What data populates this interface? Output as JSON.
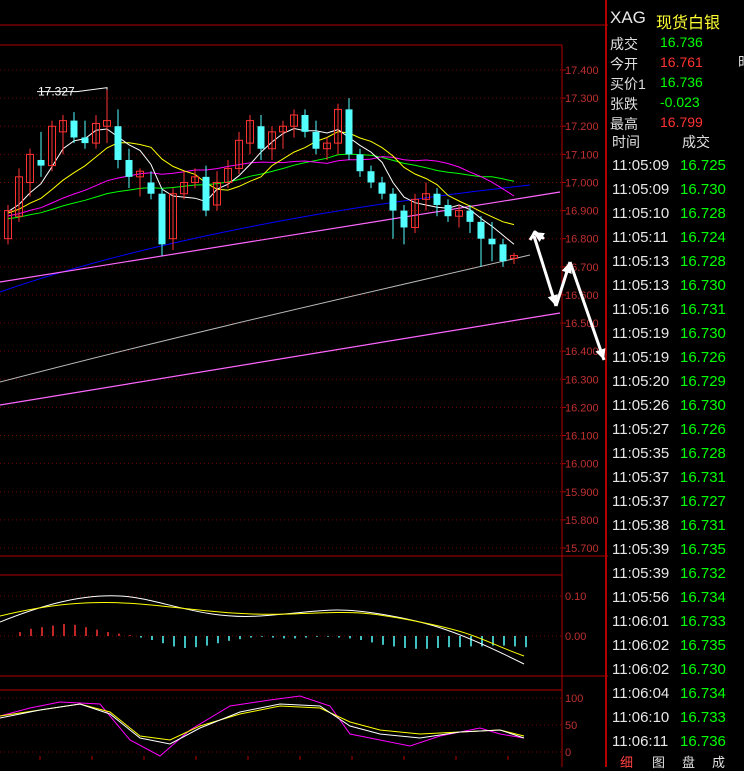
{
  "chart_data": {
    "type": "candlestick",
    "title": "",
    "price_axis_ticks": [
      "17.400",
      "17.300",
      "17.200",
      "17.100",
      "17.000",
      "16.900",
      "16.800",
      "16.700",
      "16.600",
      "16.500",
      "16.400",
      "16.300",
      "16.200",
      "16.100",
      "16.000",
      "15.900",
      "15.800",
      "15.700"
    ],
    "ylim": [
      15.7,
      17.4
    ],
    "high_annotation": "17.327",
    "candles": [
      {
        "o": 16.8,
        "h": 16.92,
        "l": 16.78,
        "c": 16.9
      },
      {
        "o": 16.88,
        "h": 17.05,
        "l": 16.86,
        "c": 17.02
      },
      {
        "o": 17.0,
        "h": 17.12,
        "l": 16.95,
        "c": 17.1
      },
      {
        "o": 17.08,
        "h": 17.18,
        "l": 17.02,
        "c": 17.06
      },
      {
        "o": 17.06,
        "h": 17.22,
        "l": 17.04,
        "c": 17.2
      },
      {
        "o": 17.18,
        "h": 17.24,
        "l": 17.1,
        "c": 17.22
      },
      {
        "o": 17.22,
        "h": 17.25,
        "l": 17.14,
        "c": 17.16
      },
      {
        "o": 17.16,
        "h": 17.22,
        "l": 17.12,
        "c": 17.14
      },
      {
        "o": 17.14,
        "h": 17.24,
        "l": 17.12,
        "c": 17.21
      },
      {
        "o": 17.2,
        "h": 17.33,
        "l": 17.14,
        "c": 17.22
      },
      {
        "o": 17.2,
        "h": 17.26,
        "l": 17.05,
        "c": 17.08
      },
      {
        "o": 17.08,
        "h": 17.12,
        "l": 16.98,
        "c": 17.02
      },
      {
        "o": 17.02,
        "h": 17.05,
        "l": 16.95,
        "c": 17.04
      },
      {
        "o": 17.0,
        "h": 17.04,
        "l": 16.94,
        "c": 16.96
      },
      {
        "o": 16.96,
        "h": 16.98,
        "l": 16.74,
        "c": 16.78
      },
      {
        "o": 16.8,
        "h": 16.98,
        "l": 16.76,
        "c": 16.96
      },
      {
        "o": 16.96,
        "h": 17.04,
        "l": 16.94,
        "c": 17.0
      },
      {
        "o": 17.0,
        "h": 17.05,
        "l": 16.98,
        "c": 17.02
      },
      {
        "o": 17.02,
        "h": 17.06,
        "l": 16.88,
        "c": 16.9
      },
      {
        "o": 16.92,
        "h": 17.04,
        "l": 16.9,
        "c": 17.0
      },
      {
        "o": 17.0,
        "h": 17.08,
        "l": 16.98,
        "c": 17.05
      },
      {
        "o": 17.05,
        "h": 17.18,
        "l": 17.03,
        "c": 17.15
      },
      {
        "o": 17.14,
        "h": 17.24,
        "l": 17.1,
        "c": 17.22
      },
      {
        "o": 17.2,
        "h": 17.24,
        "l": 17.08,
        "c": 17.12
      },
      {
        "o": 17.12,
        "h": 17.2,
        "l": 17.08,
        "c": 17.18
      },
      {
        "o": 17.18,
        "h": 17.22,
        "l": 17.12,
        "c": 17.2
      },
      {
        "o": 17.2,
        "h": 17.26,
        "l": 17.16,
        "c": 17.24
      },
      {
        "o": 17.24,
        "h": 17.26,
        "l": 17.16,
        "c": 17.18
      },
      {
        "o": 17.18,
        "h": 17.22,
        "l": 17.1,
        "c": 17.12
      },
      {
        "o": 17.12,
        "h": 17.16,
        "l": 17.08,
        "c": 17.14
      },
      {
        "o": 17.14,
        "h": 17.28,
        "l": 17.1,
        "c": 17.26
      },
      {
        "o": 17.26,
        "h": 17.3,
        "l": 17.08,
        "c": 17.1
      },
      {
        "o": 17.1,
        "h": 17.12,
        "l": 17.02,
        "c": 17.04
      },
      {
        "o": 17.04,
        "h": 17.06,
        "l": 16.98,
        "c": 17.0
      },
      {
        "o": 17.0,
        "h": 17.02,
        "l": 16.94,
        "c": 16.96
      },
      {
        "o": 16.96,
        "h": 16.98,
        "l": 16.8,
        "c": 16.9
      },
      {
        "o": 16.9,
        "h": 16.92,
        "l": 16.78,
        "c": 16.84
      },
      {
        "o": 16.84,
        "h": 16.96,
        "l": 16.82,
        "c": 16.94
      },
      {
        "o": 16.94,
        "h": 17.0,
        "l": 16.9,
        "c": 16.96
      },
      {
        "o": 16.96,
        "h": 16.98,
        "l": 16.88,
        "c": 16.92
      },
      {
        "o": 16.92,
        "h": 16.94,
        "l": 16.86,
        "c": 16.88
      },
      {
        "o": 16.88,
        "h": 16.92,
        "l": 16.84,
        "c": 16.9
      },
      {
        "o": 16.9,
        "h": 16.92,
        "l": 16.82,
        "c": 16.86
      },
      {
        "o": 16.86,
        "h": 16.88,
        "l": 16.7,
        "c": 16.8
      },
      {
        "o": 16.8,
        "h": 16.86,
        "l": 16.72,
        "c": 16.78
      },
      {
        "o": 16.78,
        "h": 16.8,
        "l": 16.7,
        "c": 16.72
      },
      {
        "o": 16.73,
        "h": 16.75,
        "l": 16.71,
        "c": 16.74
      }
    ],
    "macd_axis_ticks": [
      "0.10",
      "0.00"
    ],
    "macd_hist": [
      0.01,
      0.018,
      0.022,
      0.026,
      0.03,
      0.028,
      0.022,
      0.016,
      0.01,
      0.006,
      0.002,
      -0.004,
      -0.01,
      -0.018,
      -0.026,
      -0.03,
      -0.028,
      -0.024,
      -0.018,
      -0.012,
      -0.008,
      -0.004,
      -0.002,
      -0.004,
      -0.006,
      -0.006,
      -0.004,
      -0.002,
      -0.002,
      -0.004,
      -0.006,
      -0.01,
      -0.016,
      -0.022,
      -0.026,
      -0.03,
      -0.032,
      -0.032,
      -0.03,
      -0.028,
      -0.028,
      -0.026,
      -0.026,
      -0.024,
      -0.024,
      -0.026,
      -0.028
    ],
    "kdj_axis_ticks": [
      "100",
      "50",
      "0"
    ],
    "colors": {
      "up": "#ff3232",
      "down": "#54ffff",
      "grid": "#7a0000",
      "axis_text": "#c03030",
      "ma5": "#ffffff",
      "ma10": "#ffff00",
      "ma20": "#ff00ff",
      "ma30": "#00ff00",
      "ma60": "#0000ff",
      "ma120": "#bbbbbb",
      "trend": "#ff66ff",
      "arrow": "#ffffff"
    }
  },
  "quote": {
    "symbol": "XAG",
    "name": "现货白银",
    "fields": [
      {
        "label": "成交",
        "value": "16.736",
        "color": "#00ff00"
      },
      {
        "label": "今开",
        "value": "16.761",
        "color": "#ff3232"
      },
      {
        "label": "买价1",
        "value": "16.736",
        "color": "#00ff00"
      },
      {
        "label": "张跌",
        "value": "-0.023",
        "color": "#00ff00"
      },
      {
        "label": "最高",
        "value": "16.799",
        "color": "#ff3232"
      }
    ],
    "side_glyph": "时"
  },
  "ticks": {
    "headers": [
      "时间",
      "成交"
    ],
    "rows": [
      {
        "time": "11:05:09",
        "price": "16.725",
        "color": "#00ff00"
      },
      {
        "time": "11:05:09",
        "price": "16.730",
        "color": "#00ff00"
      },
      {
        "time": "11:05:10",
        "price": "16.728",
        "color": "#00ff00"
      },
      {
        "time": "11:05:11",
        "price": "16.724",
        "color": "#00ff00"
      },
      {
        "time": "11:05:13",
        "price": "16.728",
        "color": "#00ff00"
      },
      {
        "time": "11:05:13",
        "price": "16.730",
        "color": "#00ff00"
      },
      {
        "time": "11:05:16",
        "price": "16.731",
        "color": "#00ff00"
      },
      {
        "time": "11:05:19",
        "price": "16.730",
        "color": "#00ff00"
      },
      {
        "time": "11:05:19",
        "price": "16.726",
        "color": "#00ff00"
      },
      {
        "time": "11:05:20",
        "price": "16.729",
        "color": "#00ff00"
      },
      {
        "time": "11:05:26",
        "price": "16.730",
        "color": "#00ff00"
      },
      {
        "time": "11:05:27",
        "price": "16.726",
        "color": "#00ff00"
      },
      {
        "time": "11:05:35",
        "price": "16.728",
        "color": "#00ff00"
      },
      {
        "time": "11:05:37",
        "price": "16.731",
        "color": "#00ff00"
      },
      {
        "time": "11:05:37",
        "price": "16.727",
        "color": "#00ff00"
      },
      {
        "time": "11:05:38",
        "price": "16.731",
        "color": "#00ff00"
      },
      {
        "time": "11:05:39",
        "price": "16.735",
        "color": "#00ff00"
      },
      {
        "time": "11:05:39",
        "price": "16.732",
        "color": "#00ff00"
      },
      {
        "time": "11:05:56",
        "price": "16.734",
        "color": "#00ff00"
      },
      {
        "time": "11:06:01",
        "price": "16.733",
        "color": "#00ff00"
      },
      {
        "time": "11:06:02",
        "price": "16.735",
        "color": "#00ff00"
      },
      {
        "time": "11:06:02",
        "price": "16.730",
        "color": "#00ff00"
      },
      {
        "time": "11:06:04",
        "price": "16.734",
        "color": "#00ff00"
      },
      {
        "time": "11:06:10",
        "price": "16.733",
        "color": "#00ff00"
      },
      {
        "time": "11:06:11",
        "price": "16.736",
        "color": "#00ff00"
      }
    ],
    "bottom_tabs": [
      "细",
      "图",
      "盘",
      "成"
    ]
  }
}
